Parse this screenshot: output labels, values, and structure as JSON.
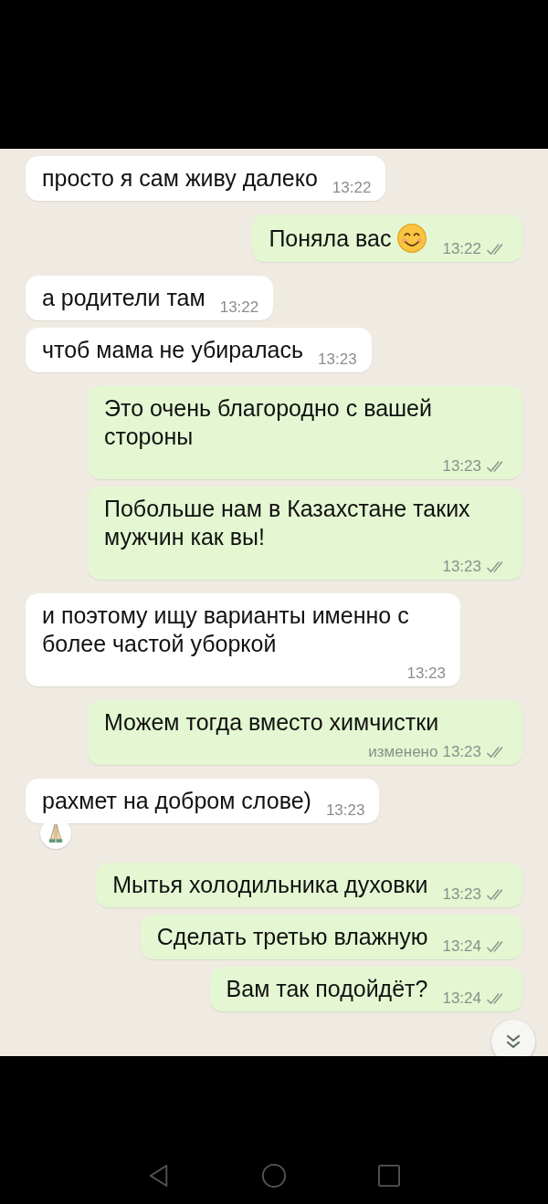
{
  "messages": [
    {
      "kind": "in",
      "text": "просто я сам живу далеко",
      "time": "13:22"
    },
    {
      "kind": "out",
      "text": "Поняла вас",
      "smile_emoji": true,
      "time": "13:22"
    },
    {
      "kind": "in",
      "text": "а родители там",
      "time": "13:22"
    },
    {
      "kind": "in",
      "text": "чтоб мама не убиралась",
      "time": "13:23"
    },
    {
      "kind": "out",
      "text": "Это очень благородно с вашей стороны",
      "time": "13:23"
    },
    {
      "kind": "out",
      "text": "Побольше нам в Казахстане таких мужчин как вы!",
      "time": "13:23"
    },
    {
      "kind": "in",
      "text": "и поэтому ищу варианты именно с более частой уборкой",
      "time": "13:23"
    },
    {
      "kind": "out",
      "text": "Можем тогда вместо химчистки",
      "edited": "изменено",
      "time": "13:23"
    },
    {
      "kind": "in",
      "text": "рахмет на добром слове)",
      "time": "13:23",
      "praying_reaction": true
    },
    {
      "kind": "out",
      "text": "Мытья холодильника духовки",
      "time": "13:23"
    },
    {
      "kind": "out",
      "text": "Сделать третью влажную",
      "time": "13:24"
    },
    {
      "kind": "out",
      "text": "Вам так подойдёт?",
      "time": "13:24"
    }
  ]
}
